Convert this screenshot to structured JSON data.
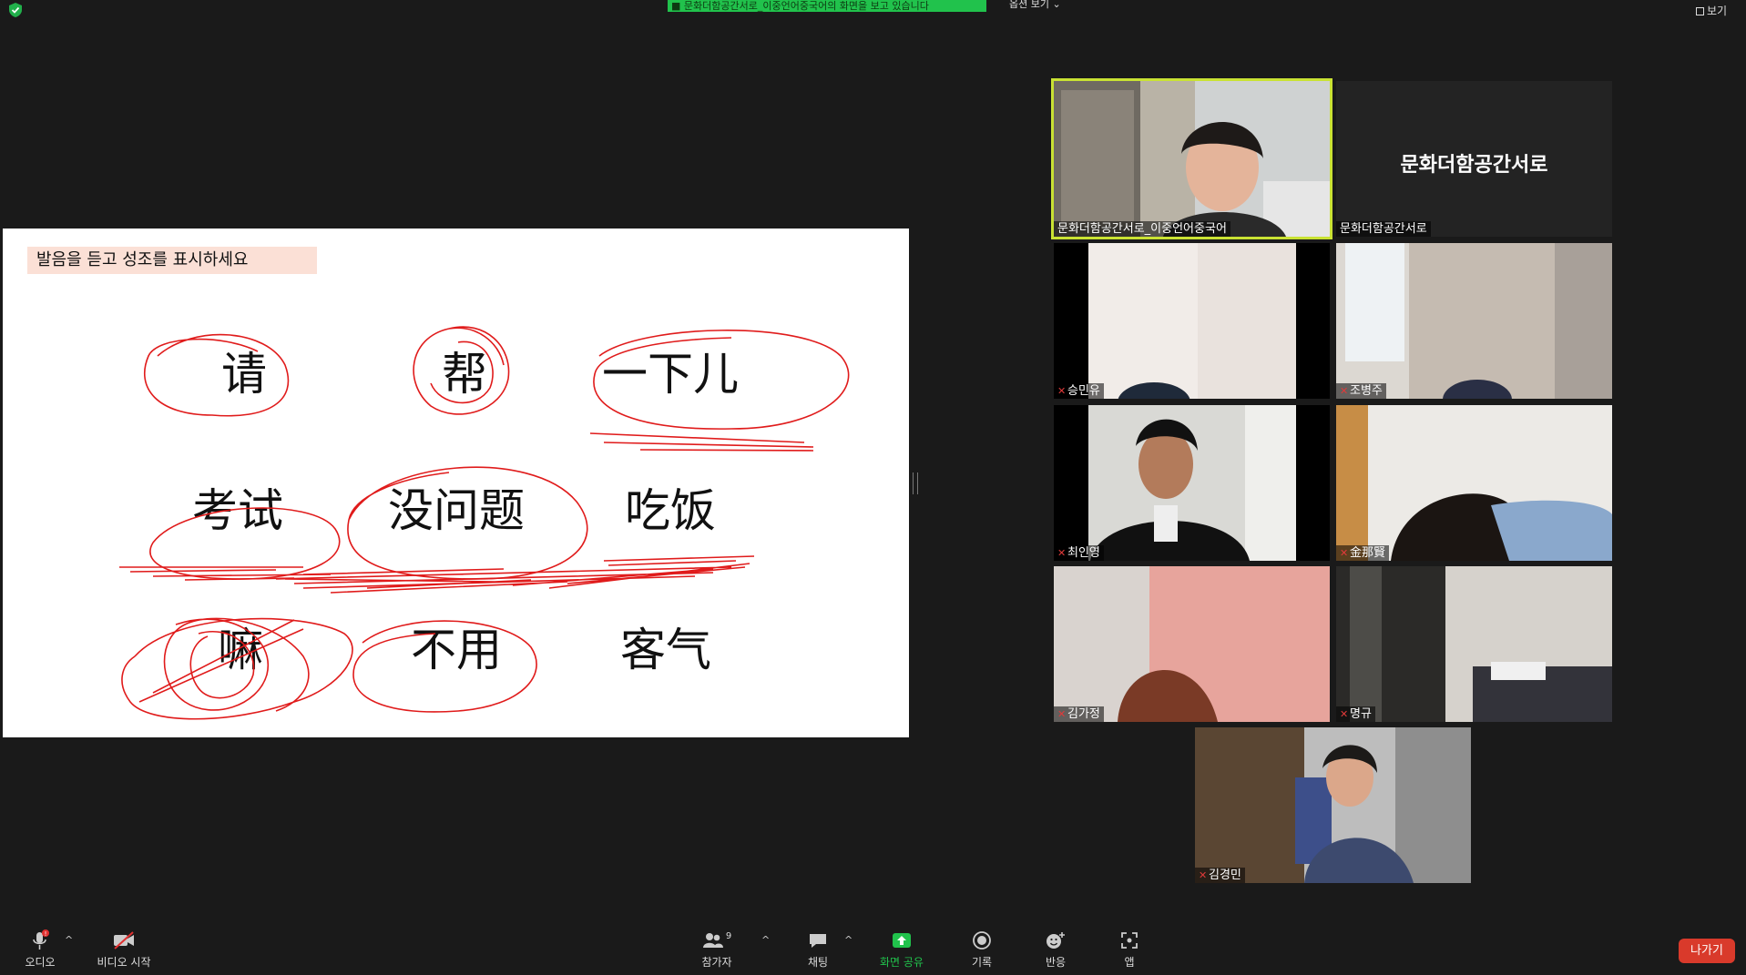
{
  "top_bar": {
    "share_banner": "■ 문화더함공간서로_이중언어중국어의 화면을 보고 있습니다",
    "view_options": "옵션 보기 ⌄",
    "view_label": "보기"
  },
  "slide": {
    "instruction": "발음을 듣고 성조를 표시하세요",
    "words": [
      "请",
      "帮",
      "一下儿",
      "考试",
      "没问题",
      "吃饭",
      "嘛",
      "不用",
      "客气"
    ],
    "annotation_color": "#e01b1b"
  },
  "participants": [
    {
      "name": "문화더함공간서로_이중언어중국어",
      "muted": false,
      "active_speaker": true
    },
    {
      "name": "문화더함공간서로",
      "muted": false,
      "video": false,
      "display_name": "문화더함공간서로"
    },
    {
      "name": "승민유",
      "muted": true
    },
    {
      "name": "조병주",
      "muted": true
    },
    {
      "name": "최인영",
      "muted": true
    },
    {
      "name": "金那賢",
      "muted": true
    },
    {
      "name": "김가정",
      "muted": true
    },
    {
      "name": "명규",
      "muted": true
    },
    {
      "name": "김경민",
      "muted": true
    }
  ],
  "toolbar": {
    "audio": "오디오",
    "video": "비디오 시작",
    "participants": "참가자",
    "participants_count": "9",
    "chat": "채팅",
    "share": "화면 공유",
    "record": "기록",
    "reactions": "반응",
    "apps": "앱",
    "leave": "나가기",
    "audio_badge": "!",
    "share_color": "#21c24c"
  }
}
